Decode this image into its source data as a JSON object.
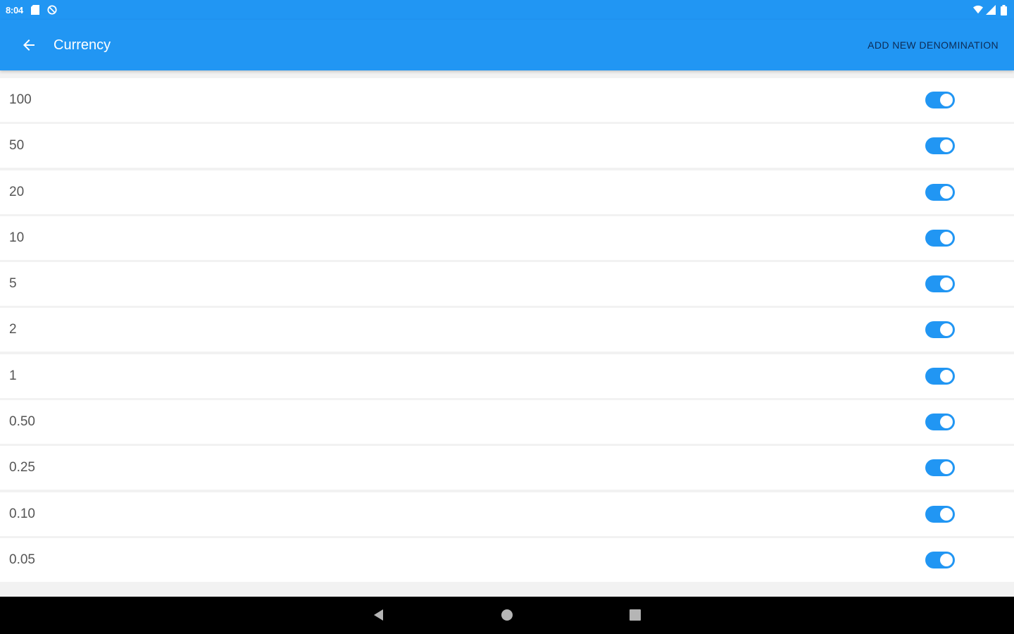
{
  "status_bar": {
    "time": "8:04",
    "icons_left": [
      "sd-card-icon",
      "sync-disabled-icon"
    ],
    "icons_right": [
      "wifi-icon",
      "signal-icon",
      "battery-icon"
    ]
  },
  "app_bar": {
    "title": "Currency",
    "action_label": "ADD NEW DENOMINATION",
    "back_icon": "arrow-back-icon"
  },
  "denominations": [
    {
      "label": "100",
      "enabled": true
    },
    {
      "label": "50",
      "enabled": true
    },
    {
      "label": "20",
      "enabled": true
    },
    {
      "label": "10",
      "enabled": true
    },
    {
      "label": "5",
      "enabled": true
    },
    {
      "label": "2",
      "enabled": true
    },
    {
      "label": "1",
      "enabled": true
    },
    {
      "label": "0.50",
      "enabled": true
    },
    {
      "label": "0.25",
      "enabled": true
    },
    {
      "label": "0.10",
      "enabled": true
    },
    {
      "label": "0.05",
      "enabled": true
    }
  ],
  "nav_bar": {
    "buttons": [
      "back-triangle-icon",
      "home-circle-icon",
      "recents-square-icon"
    ]
  },
  "colors": {
    "primary": "#2196f3",
    "action_text": "#0d2b55",
    "row_bg": "#ffffff",
    "divider_bg": "#f2f2f2",
    "label_text": "#555555",
    "nav_bg": "#000000"
  }
}
